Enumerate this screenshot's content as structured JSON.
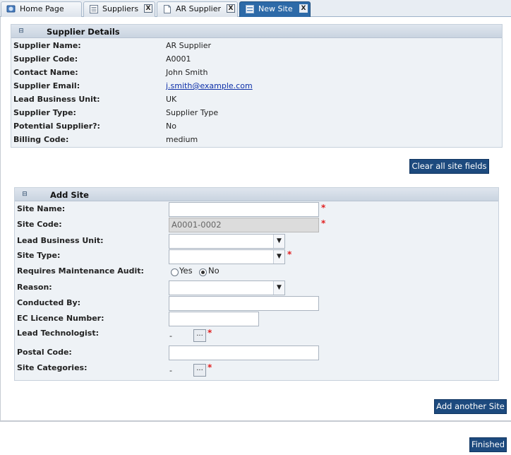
{
  "tabs": [
    {
      "label": "Home Page",
      "icon": "home-icon",
      "closable": false,
      "active": false
    },
    {
      "label": "Suppliers",
      "icon": "list-icon",
      "closable": true,
      "active": false
    },
    {
      "label": "AR Supplier",
      "icon": "document-icon",
      "closable": true,
      "active": false
    },
    {
      "label": "New Site",
      "icon": "form-icon",
      "closable": true,
      "active": true
    }
  ],
  "close_glyph": "X",
  "supplier_details": {
    "title": "Supplier Details",
    "collapse_glyph": "⊟",
    "rows": [
      {
        "label": "Supplier Name:",
        "value": "AR Supplier"
      },
      {
        "label": "Supplier Code:",
        "value": "A0001"
      },
      {
        "label": "Contact Name:",
        "value": "John Smith"
      },
      {
        "label": "Supplier Email:",
        "value": "j.smith@example.com"
      },
      {
        "label": "Lead Business Unit:",
        "value": "UK"
      },
      {
        "label": "Supplier Type:",
        "value": "Supplier Type"
      },
      {
        "label": "Potential Supplier?:",
        "value": "No"
      },
      {
        "label": "Billing Code:",
        "value": "medium"
      }
    ]
  },
  "buttons": {
    "clear_all": "Clear all site fields",
    "add_another": "Add another Site",
    "finished": "Finished"
  },
  "add_site": {
    "title": "Add Site",
    "collapse_glyph": "⊟",
    "required_mark": "*",
    "lookup_glyph": "...",
    "select_arrow": "▼",
    "fields": {
      "site_name": {
        "label": "Site Name:",
        "value": ""
      },
      "site_code": {
        "label": "Site Code:",
        "value": "A0001-0002"
      },
      "lead_business_unit": {
        "label": "Lead Business Unit:",
        "value": ""
      },
      "site_type": {
        "label": "Site Type:",
        "value": ""
      },
      "requires_audit": {
        "label": "Requires Maintenance Audit:",
        "option_yes": "Yes",
        "option_no": "No",
        "selected": "No"
      },
      "reason": {
        "label": "Reason:",
        "value": ""
      },
      "conducted_by": {
        "label": "Conducted By:",
        "value": ""
      },
      "ec_licence": {
        "label": "EC Licence Number:",
        "value": ""
      },
      "lead_technologist": {
        "label": "Lead Technologist:",
        "value": "-"
      },
      "postal_code": {
        "label": "Postal Code:",
        "value": ""
      },
      "site_categories": {
        "label": "Site Categories:",
        "value": "-"
      }
    }
  }
}
